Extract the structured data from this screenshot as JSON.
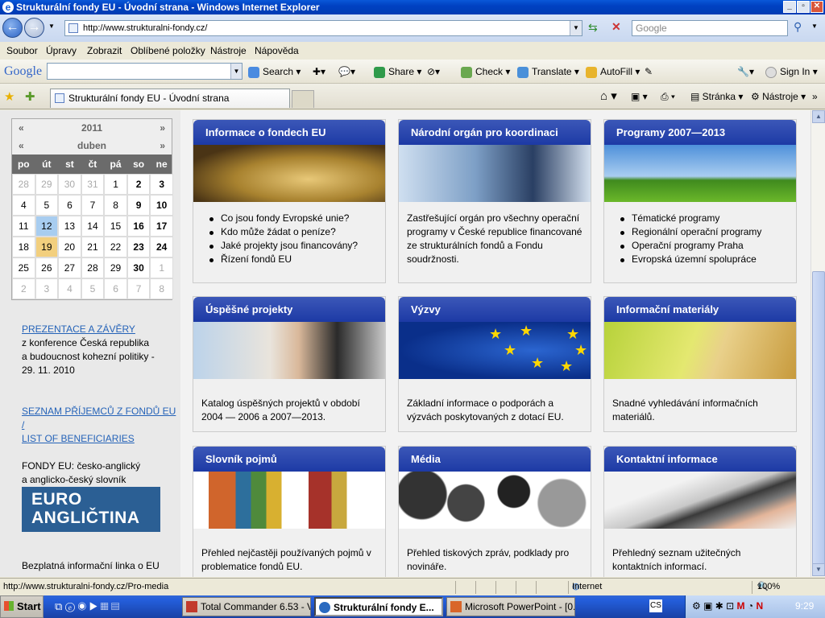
{
  "window": {
    "title": "Strukturální fondy EU - Úvodní strana - Windows Internet Explorer"
  },
  "address": {
    "url": "http://www.strukturalni-fondy.cz/",
    "search_placeholder": "Google"
  },
  "menu": [
    "Soubor",
    "Úpravy",
    "Zobrazit",
    "Oblíbené položky",
    "Nástroje",
    "Nápověda"
  ],
  "gtoolbar": {
    "logo": "Google",
    "search": "Search",
    "share": "Share",
    "check": "Check",
    "translate": "Translate",
    "autofill": "AutoFill",
    "signin": "Sign In"
  },
  "tabs": {
    "active": "Strukturální fondy EU - Úvodní strana",
    "page_menu": "Stránka",
    "tools_menu": "Nástroje"
  },
  "calendar": {
    "year": "2011",
    "month": "duben",
    "prev": "«",
    "next": "»",
    "weekdays": [
      "po",
      "út",
      "st",
      "čt",
      "pá",
      "so",
      "ne"
    ],
    "days": [
      {
        "d": "28",
        "c": "o"
      },
      {
        "d": "29",
        "c": "o"
      },
      {
        "d": "30",
        "c": "o"
      },
      {
        "d": "31",
        "c": "o"
      },
      {
        "d": "1",
        "c": ""
      },
      {
        "d": "2",
        "c": "b"
      },
      {
        "d": "3",
        "c": "b"
      },
      {
        "d": "4",
        "c": ""
      },
      {
        "d": "5",
        "c": ""
      },
      {
        "d": "6",
        "c": ""
      },
      {
        "d": "7",
        "c": ""
      },
      {
        "d": "8",
        "c": ""
      },
      {
        "d": "9",
        "c": "b"
      },
      {
        "d": "10",
        "c": "b"
      },
      {
        "d": "11",
        "c": ""
      },
      {
        "d": "12",
        "c": "t"
      },
      {
        "d": "13",
        "c": ""
      },
      {
        "d": "14",
        "c": ""
      },
      {
        "d": "15",
        "c": ""
      },
      {
        "d": "16",
        "c": "b"
      },
      {
        "d": "17",
        "c": "b"
      },
      {
        "d": "18",
        "c": ""
      },
      {
        "d": "19",
        "c": "s"
      },
      {
        "d": "20",
        "c": ""
      },
      {
        "d": "21",
        "c": ""
      },
      {
        "d": "22",
        "c": ""
      },
      {
        "d": "23",
        "c": "b"
      },
      {
        "d": "24",
        "c": "b"
      },
      {
        "d": "25",
        "c": ""
      },
      {
        "d": "26",
        "c": ""
      },
      {
        "d": "27",
        "c": ""
      },
      {
        "d": "28",
        "c": ""
      },
      {
        "d": "29",
        "c": ""
      },
      {
        "d": "30",
        "c": "b"
      },
      {
        "d": "1",
        "c": "o"
      },
      {
        "d": "2",
        "c": "o"
      },
      {
        "d": "3",
        "c": "o"
      },
      {
        "d": "4",
        "c": "o"
      },
      {
        "d": "5",
        "c": "o"
      },
      {
        "d": "6",
        "c": "o"
      },
      {
        "d": "7",
        "c": "o"
      },
      {
        "d": "8",
        "c": "o"
      }
    ]
  },
  "sidebar": {
    "prez_link": "PREZENTACE A ZÁVĚRY",
    "prez_text1": "z konference",
    "prez_text2": "Česká republika",
    "prez_text3": "a budoucnost kohezní politiky -",
    "prez_text4": "29. 11. 2010",
    "seznam_link1": "SEZNAM PŘÍJEMCŮ Z FONDŮ EU /",
    "seznam_link2": "LIST OF BENEFICIARIES",
    "fondy_text1": "FONDY EU: česko-anglický",
    "fondy_text2": "a anglicko-český slovník",
    "euro1": "EURO",
    "euro2": "ANGLIČTINA",
    "linka": "Bezplatná informační linka o EU"
  },
  "cards": [
    {
      "title": "Informace o fondech EU",
      "items": [
        "Co jsou fondy Evropské unie?",
        "Kdo může žádat o peníze?",
        "Jaké projekty jsou financovány?",
        "Řízení fondů EU"
      ]
    },
    {
      "title": "Národní orgán pro koordinaci",
      "text": "Zastřešující orgán pro všechny operační programy v České republice financované ze strukturálních fondů a Fondu soudržnosti."
    },
    {
      "title": "Programy 2007—2013",
      "items": [
        "Tématické programy",
        "Regionální operační programy",
        "Operační programy Praha",
        "Evropská územní spolupráce"
      ]
    },
    {
      "title": "Úspěšné projekty",
      "text": "Katalog úspěšných projektů v období 2004 — 2006 a 2007—2013."
    },
    {
      "title": "Výzvy",
      "text": "Základní informace o podporách a výzvách poskytovaných z dotací EU."
    },
    {
      "title": "Informační materiály",
      "text": "Snadné vyhledávání informačních materiálů."
    },
    {
      "title": "Slovník pojmů",
      "text": "Přehled nejčastěji používaných pojmů v problematice fondů EU."
    },
    {
      "title": "Média",
      "text": "Přehled tiskových zpráv, podklady pro novináře."
    },
    {
      "title": "Kontaktní informace",
      "text": "Přehledný seznam užitečných kontaktních informací."
    }
  ],
  "status": {
    "url": "http://www.strukturalni-fondy.cz/Pro-media",
    "zone": "Internet",
    "zoom": "100%"
  },
  "taskbar": {
    "start": "Start",
    "items": [
      "Total Commander 6.53 - V...",
      "Strukturální fondy E...",
      "Microsoft PowerPoint - [0..."
    ],
    "clock": "9:29"
  }
}
